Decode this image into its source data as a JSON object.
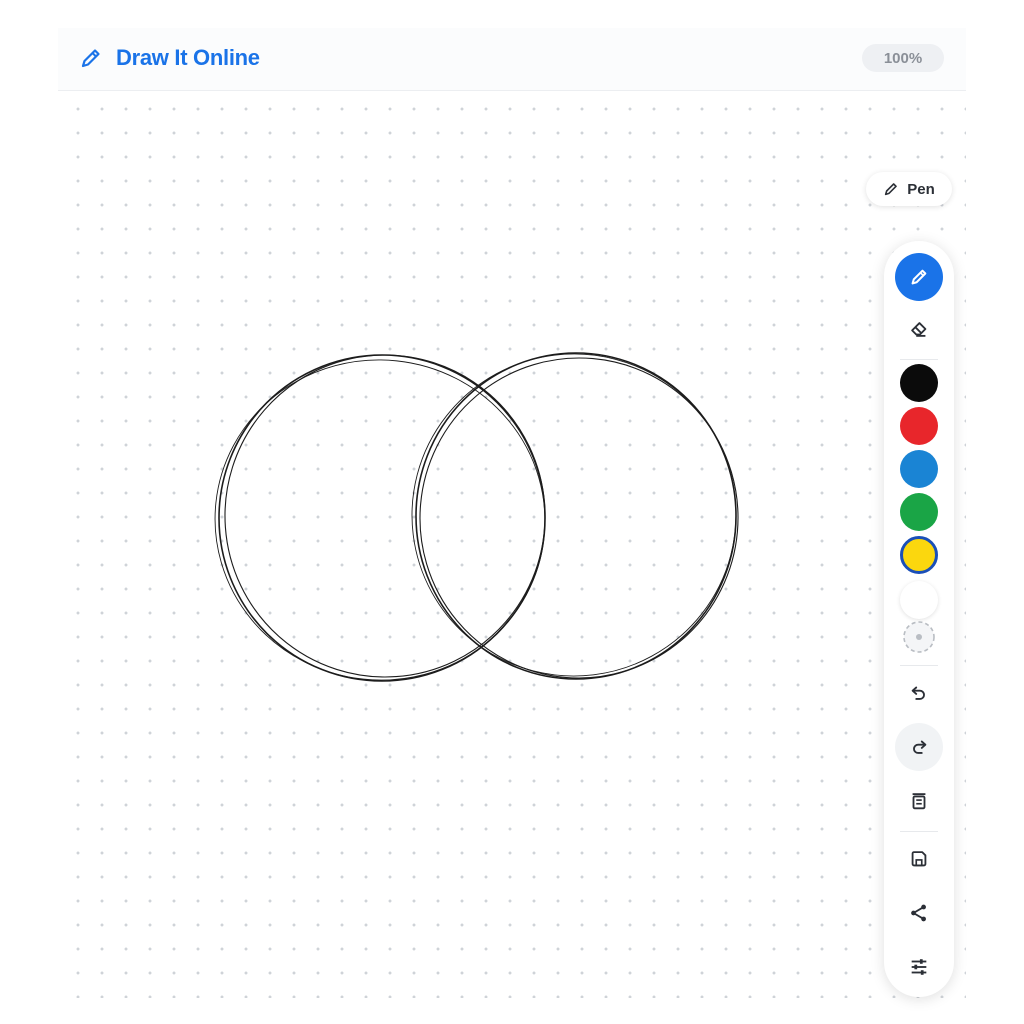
{
  "app": {
    "title": "Draw It Online",
    "zoom": "100%"
  },
  "tool": {
    "current_label": "Pen"
  },
  "toolbar": {
    "palette": [
      {
        "name": "black",
        "color": "#0b0b0b"
      },
      {
        "name": "red",
        "color": "#e8262b"
      },
      {
        "name": "blue",
        "color": "#1a84d4"
      },
      {
        "name": "green",
        "color": "#1aa546"
      },
      {
        "name": "yellow",
        "color": "#fbd70e",
        "selected": true
      },
      {
        "name": "white",
        "color": "#ffffff"
      }
    ],
    "tools": [
      "pen-icon",
      "eraser-icon",
      "brush-size-icon",
      "undo-icon",
      "redo-icon",
      "clear-icon",
      "save-icon",
      "share-icon",
      "settings-icon"
    ]
  },
  "colors": {
    "accent": "#1a73e8",
    "ink": "#1c1c1c"
  }
}
